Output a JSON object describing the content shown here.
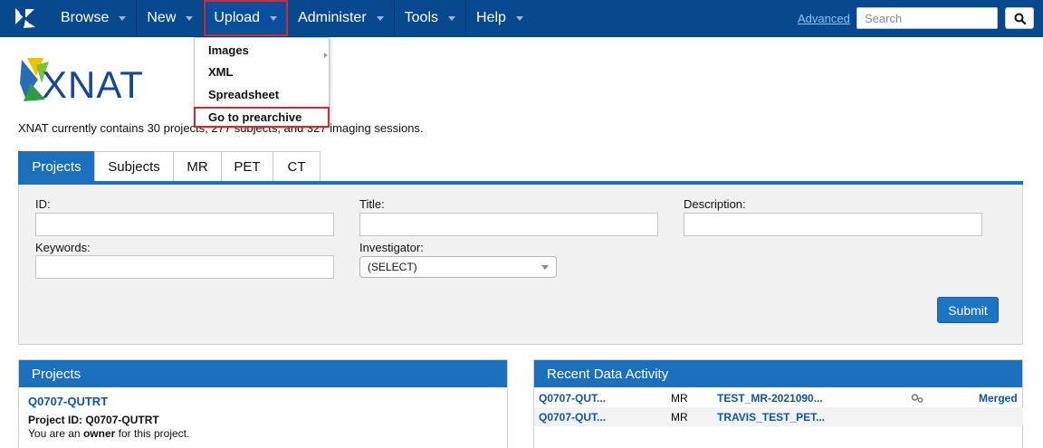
{
  "navbar": {
    "items": [
      {
        "label": "Browse"
      },
      {
        "label": "New"
      },
      {
        "label": "Upload"
      },
      {
        "label": "Administer"
      },
      {
        "label": "Tools"
      },
      {
        "label": "Help"
      }
    ],
    "advanced_label": "Advanced",
    "search_placeholder": "Search",
    "search_icon": "search-icon",
    "colors": {
      "bar": "#07488f",
      "highlight": "#d12b2b"
    }
  },
  "upload_menu": {
    "items": [
      {
        "label": "Images",
        "has_submenu": true
      },
      {
        "label": "XML"
      },
      {
        "label": "Spreadsheet"
      },
      {
        "label": "Go to prearchive"
      }
    ]
  },
  "intro": {
    "text": "XNAT currently contains 30 projects, 277 subjects, and 327 imaging sessions."
  },
  "tabs": [
    {
      "label": "Projects",
      "active": true
    },
    {
      "label": "Subjects"
    },
    {
      "label": "MR"
    },
    {
      "label": "PET"
    },
    {
      "label": "CT"
    }
  ],
  "search_form": {
    "id_label": "ID:",
    "title_label": "Title:",
    "description_label": "Description:",
    "keywords_label": "Keywords:",
    "investigator_label": "Investigator:",
    "investigator_value": "(SELECT)",
    "submit_label": "Submit"
  },
  "projects_panel": {
    "title": "Projects",
    "project_link": "Q0707-QUTRT",
    "project_id_label": "Project ID:",
    "project_id": "Q0707-QUTRT",
    "role_prefix": "You are an",
    "role": "owner",
    "role_suffix": "for this project."
  },
  "activity_panel": {
    "title": "Recent Data Activity",
    "rows": [
      {
        "project": "Q0707-QUT...",
        "modality": "MR",
        "session": "TEST_MR-2021090...",
        "icon": "gears-icon",
        "status": "Merged"
      },
      {
        "project": "Q0707-QUT...",
        "modality": "MR",
        "session": "TRAVIS_TEST_PET...",
        "status": ""
      }
    ]
  }
}
